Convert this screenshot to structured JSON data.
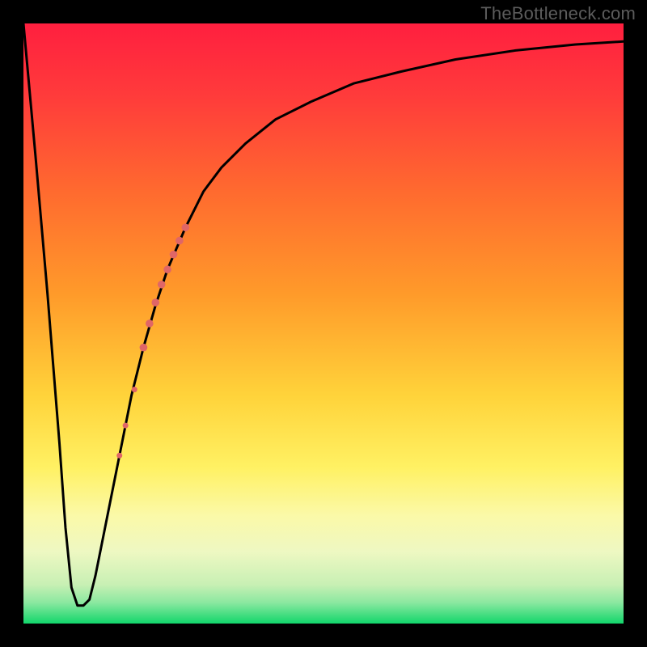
{
  "watermark": "TheBottleneck.com",
  "colors": {
    "frame": "#000000",
    "curve": "#000000",
    "marker_fill": "#e06666",
    "marker_stroke": "#cc5555",
    "gradient_stops": [
      {
        "offset": 0.0,
        "color": "#ff1f3f"
      },
      {
        "offset": 0.12,
        "color": "#ff3b3b"
      },
      {
        "offset": 0.28,
        "color": "#ff6a2f"
      },
      {
        "offset": 0.45,
        "color": "#ff9a2a"
      },
      {
        "offset": 0.62,
        "color": "#ffd33a"
      },
      {
        "offset": 0.74,
        "color": "#fff163"
      },
      {
        "offset": 0.82,
        "color": "#fbf9a8"
      },
      {
        "offset": 0.88,
        "color": "#eef8c2"
      },
      {
        "offset": 0.935,
        "color": "#c8f0b4"
      },
      {
        "offset": 0.965,
        "color": "#8be8a0"
      },
      {
        "offset": 1.0,
        "color": "#12d66b"
      }
    ]
  },
  "chart_data": {
    "type": "line",
    "title": "",
    "xlabel": "",
    "ylabel": "",
    "xlim": [
      0,
      100
    ],
    "ylim": [
      0,
      100
    ],
    "series": [
      {
        "name": "bottleneck-curve",
        "x": [
          0,
          2,
          4,
          6,
          7,
          8,
          9,
          10,
          11,
          12,
          14,
          16,
          18,
          20,
          22,
          24,
          27,
          30,
          33,
          37,
          42,
          48,
          55,
          63,
          72,
          82,
          92,
          100
        ],
        "y": [
          100,
          78,
          55,
          30,
          16,
          6,
          3,
          3,
          4,
          8,
          18,
          28,
          38,
          46,
          53,
          59,
          66,
          72,
          76,
          80,
          84,
          87,
          90,
          92,
          94,
          95.5,
          96.5,
          97
        ]
      }
    ],
    "markers": {
      "name": "highlighted-points",
      "points": [
        {
          "x": 16.0,
          "y": 28.0,
          "r": 3.5
        },
        {
          "x": 17.0,
          "y": 33.0,
          "r": 3.5
        },
        {
          "x": 18.5,
          "y": 39.0,
          "r": 3.5
        },
        {
          "x": 20.0,
          "y": 46.0,
          "r": 4.8
        },
        {
          "x": 21.0,
          "y": 50.0,
          "r": 4.8
        },
        {
          "x": 22.0,
          "y": 53.5,
          "r": 4.8
        },
        {
          "x": 23.0,
          "y": 56.5,
          "r": 4.8
        },
        {
          "x": 24.0,
          "y": 59.0,
          "r": 4.8
        },
        {
          "x": 25.0,
          "y": 61.5,
          "r": 4.8
        },
        {
          "x": 26.0,
          "y": 63.8,
          "r": 4.8
        },
        {
          "x": 27.0,
          "y": 66.0,
          "r": 4.8
        }
      ]
    }
  }
}
